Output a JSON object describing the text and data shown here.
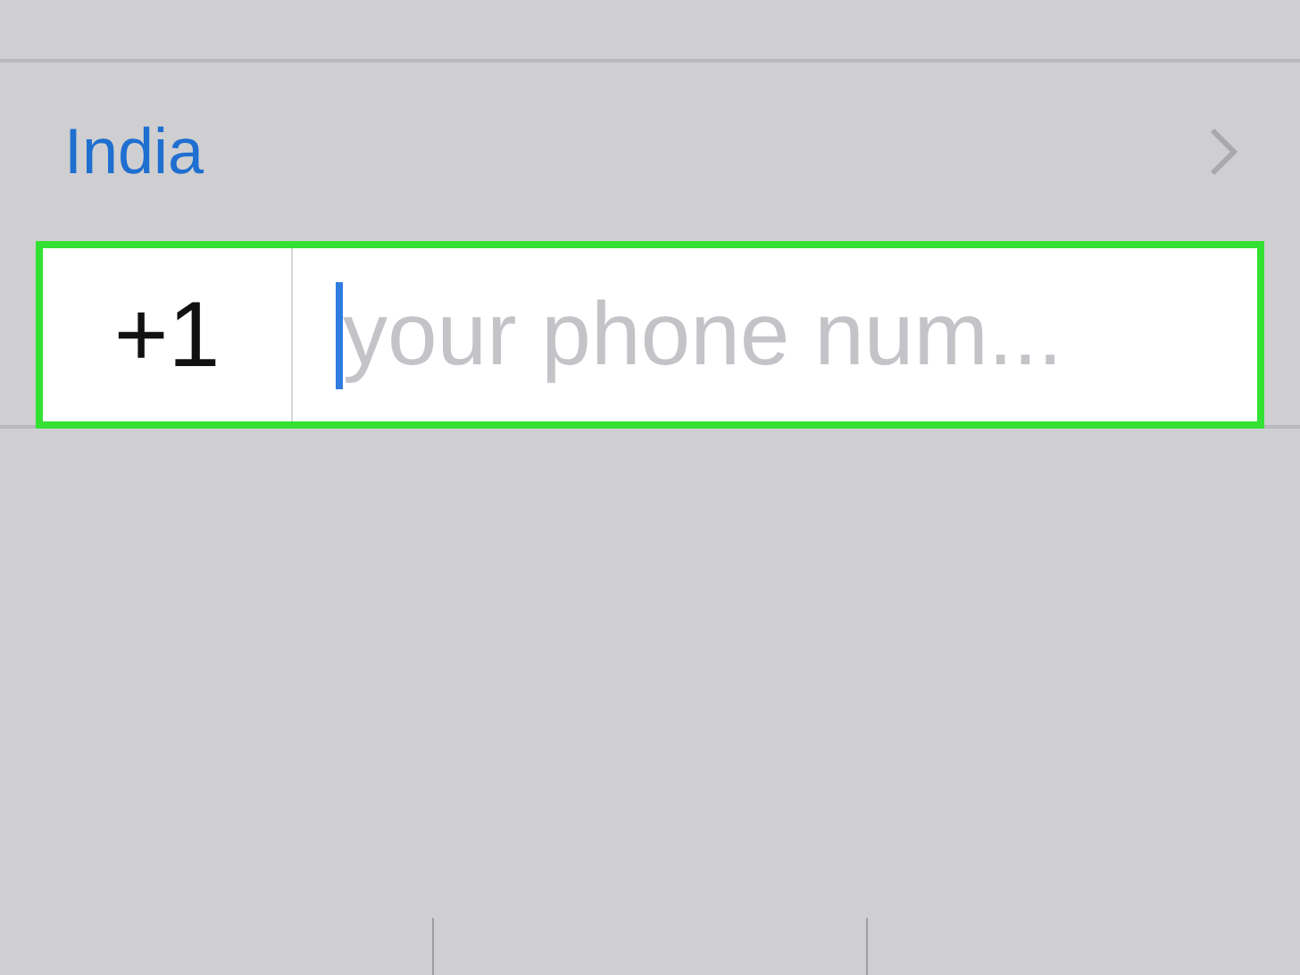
{
  "country_row": {
    "label": "India"
  },
  "phone_field": {
    "code": "+1",
    "placeholder": "your phone num...",
    "focused": true,
    "highlighted": true
  }
}
